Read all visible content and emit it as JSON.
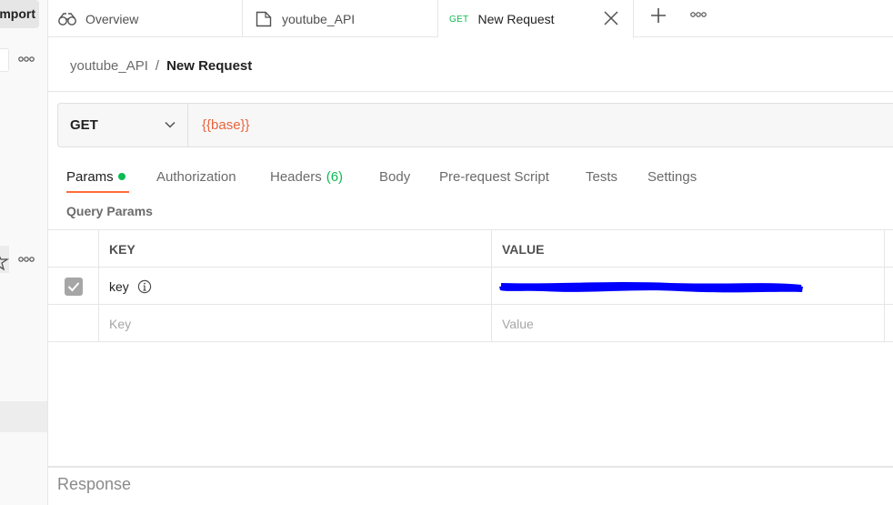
{
  "sidebar": {
    "import_label": "Import"
  },
  "tabs": [
    {
      "label": "Overview",
      "icon": "overview-icon"
    },
    {
      "label": "youtube_API",
      "icon": "collection-icon"
    },
    {
      "label": "New Request",
      "method": "GET",
      "active": true
    }
  ],
  "breadcrumb": {
    "parent": "youtube_API",
    "separator": "/",
    "current": "New Request"
  },
  "request": {
    "method": "GET",
    "url": "{{base}}"
  },
  "request_tabs": [
    {
      "label": "Params",
      "active": true,
      "indicator": "dot"
    },
    {
      "label": "Authorization"
    },
    {
      "label": "Headers",
      "count": "(6)"
    },
    {
      "label": "Body"
    },
    {
      "label": "Pre-request Script"
    },
    {
      "label": "Tests"
    },
    {
      "label": "Settings"
    }
  ],
  "query_params": {
    "section_label": "Query Params",
    "headers": {
      "key": "KEY",
      "value": "VALUE"
    },
    "rows": [
      {
        "key": "key",
        "checked": true,
        "value_redacted": true
      }
    ],
    "placeholder": {
      "key": "Key",
      "value": "Value"
    }
  },
  "response": {
    "label": "Response"
  },
  "colors": {
    "accent": "#ff6c37",
    "success": "#0cbb52",
    "variable": "#e8643c",
    "redaction": "#0000ff"
  }
}
